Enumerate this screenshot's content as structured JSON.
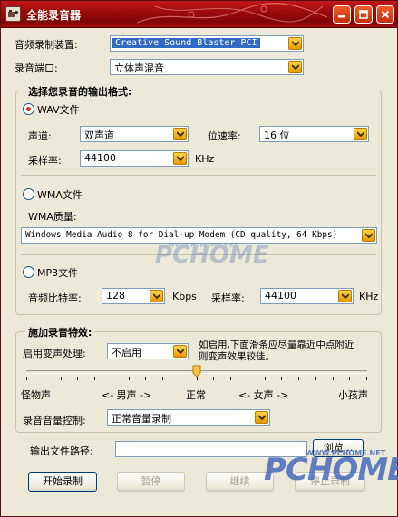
{
  "window": {
    "title": "全能录音器"
  },
  "top": {
    "device_label": "音频录制装置:",
    "device_value": "Creative Sound Blaster PCI",
    "port_label": "录音端口:",
    "port_value": "立体声混音"
  },
  "format": {
    "group_title": "选择您录音的输出格式:",
    "wav": {
      "label": "WAV文件",
      "channel_label": "声道:",
      "channel_value": "双声道",
      "bitrate_label": "位速率:",
      "bitrate_value": "16 位",
      "samplerate_label": "采样率:",
      "samplerate_value": "44100",
      "samplerate_unit": "KHz"
    },
    "wma": {
      "label": "WMA文件",
      "quality_label": "WMA质量:",
      "quality_value": "Windows Media Audio 8 for Dial-up Modem (CD quality, 64 Kbps)"
    },
    "mp3": {
      "label": "MP3文件",
      "bitrate_label": "音频比特率:",
      "bitrate_value": "128",
      "bitrate_unit": "Kbps",
      "samplerate_label": "采样率:",
      "samplerate_value": "44100",
      "samplerate_unit": "KHz"
    }
  },
  "effects": {
    "group_title": "施加录音特效:",
    "voice_label": "启用变声处理:",
    "voice_value": "不启用",
    "note": "如启用,下面滑条应尽量靠近中点附近则变声效果较佳。",
    "slider": {
      "value": 0.5,
      "labels": [
        "怪物声",
        "<- 男声 ->",
        "正常",
        "<- 女声 ->",
        "小孩声"
      ]
    },
    "volume_label": "录音音量控制:",
    "volume_value": "正常音量录制"
  },
  "output": {
    "path_label": "输出文件路径:",
    "path_value": "",
    "browse_label": "浏览..."
  },
  "buttons": {
    "start": "开始录制",
    "pause": "暂停",
    "resume": "继续",
    "stop": "停止录制"
  },
  "watermark": {
    "brand": "PCHOME",
    "url": "WWW.PCHOME.NET"
  }
}
